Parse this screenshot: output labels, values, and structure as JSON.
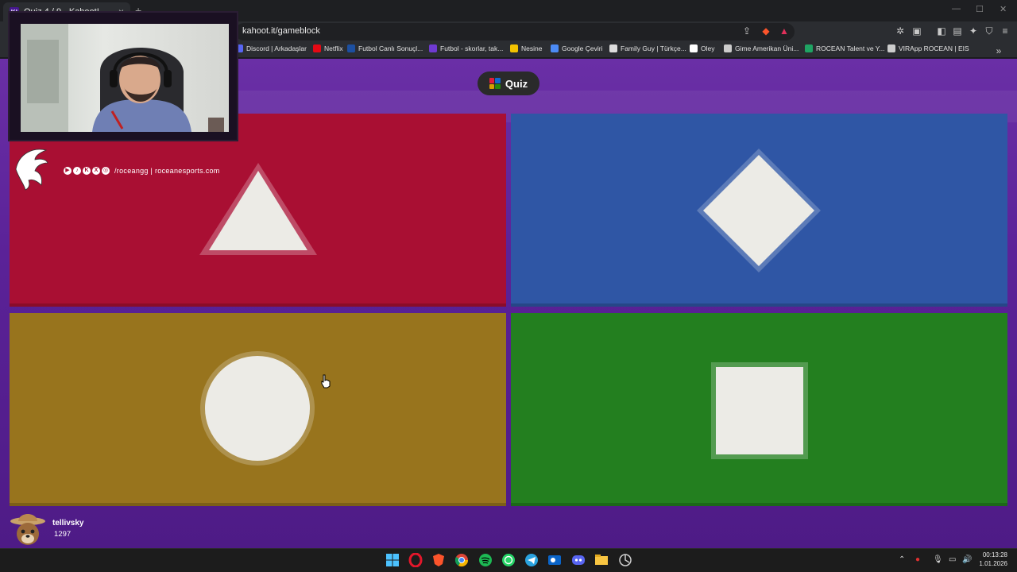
{
  "browser": {
    "tab_title": "Quiz 4 / 9 - Kahoot!",
    "tab_favicon": "K!",
    "url": "kahoot.it/gameblock",
    "bookmarks": [
      {
        "label": "Discord | Arkadaşlar",
        "icon": "discord-icon",
        "color": "#5865f2"
      },
      {
        "label": "Netflix",
        "icon": "netflix-icon",
        "color": "#e50914"
      },
      {
        "label": "Futbol Canlı Sonuçl...",
        "icon": "m-icon",
        "color": "#1c4fa0"
      },
      {
        "label": "Futbol - skorlar, tak...",
        "icon": "flashscore-icon",
        "color": "#6f3ad1"
      },
      {
        "label": "Nesine",
        "icon": "nesine-icon",
        "color": "#f2c200"
      },
      {
        "label": "Google Çeviri",
        "icon": "translate-icon",
        "color": "#4c8bf5"
      },
      {
        "label": "Family Guy | Türkçe...",
        "icon": "site-icon",
        "color": "#dddddd"
      },
      {
        "label": "Oley",
        "icon": "oley-icon",
        "color": "#ffffff"
      },
      {
        "label": "Gime Amerikan Üni...",
        "icon": "page-icon",
        "color": "#cccccc"
      },
      {
        "label": "ROCEAN Talent ve Y...",
        "icon": "sheets-icon",
        "color": "#1fa463"
      },
      {
        "label": "VIRApp ROCEAN | EIS",
        "icon": "globe-icon",
        "color": "#cccccc"
      }
    ]
  },
  "game": {
    "quiz_label": "Quiz",
    "answers": [
      {
        "shape": "triangle",
        "color": "#a90f33"
      },
      {
        "shape": "diamond",
        "color": "#2f56a5"
      },
      {
        "shape": "circle",
        "color": "#98741d"
      },
      {
        "shape": "square",
        "color": "#237f1f"
      }
    ]
  },
  "overlay": {
    "social_handle": "/roceangg | roceanesports.com"
  },
  "player": {
    "name": "tellivsky",
    "score": "1297"
  },
  "taskbar": {
    "time": "00:13:28",
    "date": "1.01.2026"
  }
}
